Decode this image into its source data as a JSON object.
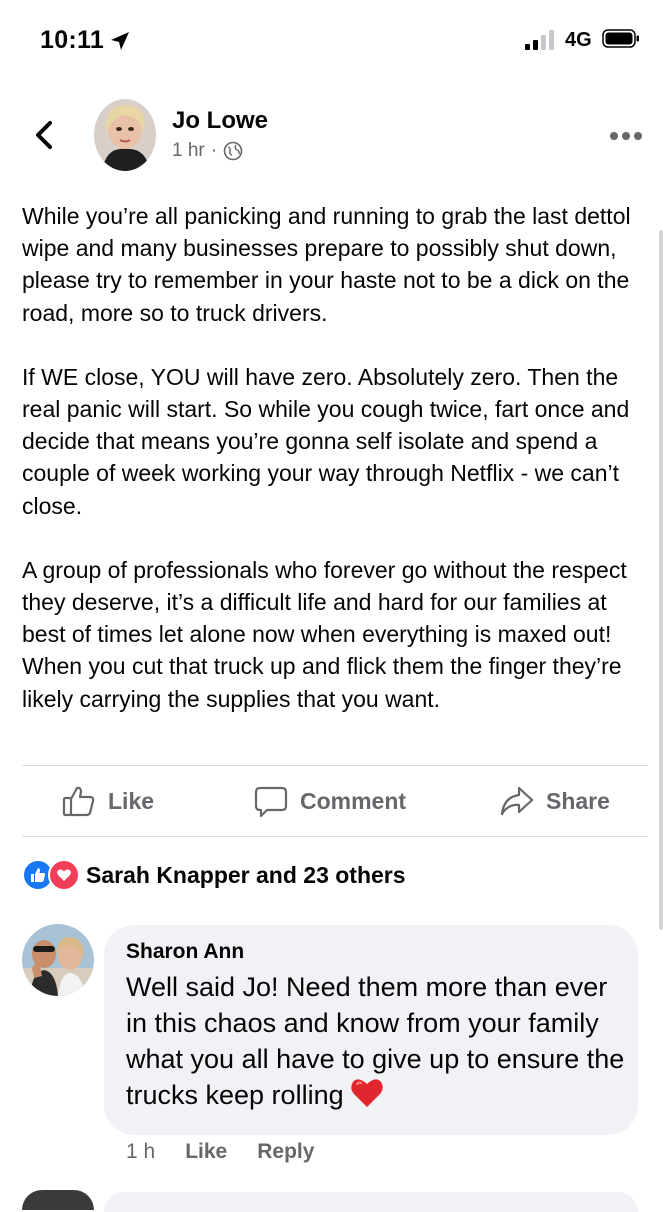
{
  "status_bar": {
    "time": "10:11",
    "network": "4G"
  },
  "post": {
    "author": "Jo Lowe",
    "time": "1 hr",
    "separator": "·",
    "paragraphs": [
      "While you’re all panicking and running to grab the last dettol wipe and many businesses prepare to possibly shut down, please try to remember in your haste not to be a dick on the road, more so to truck drivers.",
      "If WE close, YOU will have zero. Absolutely zero. Then the real panic will start. So while you cough twice, fart once and decide that means you’re gonna self isolate and spend a couple of week working your way through Netflix - we can’t close.",
      "A group of professionals who forever go without the respect they deserve, it’s a difficult life and hard for our families at best of times let alone now when everything is maxed out! When you cut that truck up and flick them the finger they’re likely carrying the supplies that you want."
    ]
  },
  "actions": {
    "like": "Like",
    "comment": "Comment",
    "share": "Share"
  },
  "reactions": {
    "text": "Sarah Knapper and 23 others"
  },
  "comment": {
    "author": "Sharon Ann",
    "text": "Well said Jo!    Need them more than ever in this chaos and know from your family what you all have to give up to ensure the trucks keep rolling",
    "time": "1 h",
    "like": "Like",
    "reply": "Reply"
  },
  "icons": {
    "back": "chevron-left-icon",
    "more": "ellipsis-icon",
    "audience": "globe-icon",
    "like": "thumbs-up-icon",
    "comment": "speech-bubble-icon",
    "share": "share-arrow-icon",
    "reaction_like": "like-reaction-icon",
    "reaction_love": "love-reaction-icon",
    "emoji": "red-heart-emoji-icon"
  },
  "colors": {
    "like_blue": "#1877f2",
    "love_red": "#f33e58",
    "secondary_text": "#65676b",
    "bubble_bg": "#f0f2f5"
  }
}
